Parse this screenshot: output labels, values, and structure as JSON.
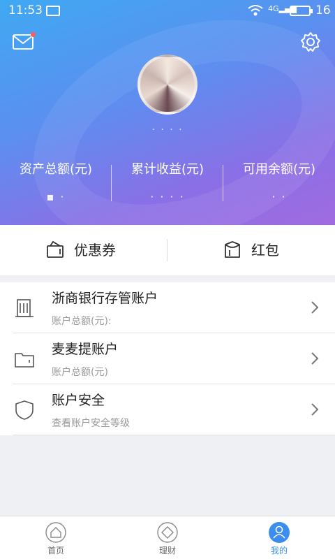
{
  "status_bar": {
    "time": "11:53",
    "battery_level": "16",
    "signal_label": "4G"
  },
  "header": {
    "nickname": "· · · ·",
    "stats": [
      {
        "label": "资产总额(元)",
        "value": "▪ ·"
      },
      {
        "label": "累计收益(元)",
        "value": "· · · ·"
      },
      {
        "label": "可用余额(元)",
        "value": "· ·"
      }
    ]
  },
  "coupons": {
    "coupon_label": "优惠券",
    "red_packet_label": "红包"
  },
  "accounts": [
    {
      "title": "浙商银行存管账户",
      "subtitle": "账户总额(元):"
    },
    {
      "title": "麦麦提账户",
      "subtitle": "账户总额(元)"
    },
    {
      "title": "账户安全",
      "subtitle": "查看账户安全等级"
    }
  ],
  "tabbar": {
    "home": "首页",
    "finance": "理财",
    "mine": "我的"
  },
  "colors": {
    "accent": "#3b8ef0",
    "header_start": "#3fa9f3",
    "header_end": "#a06be0",
    "badge": "#ff5b5b"
  }
}
